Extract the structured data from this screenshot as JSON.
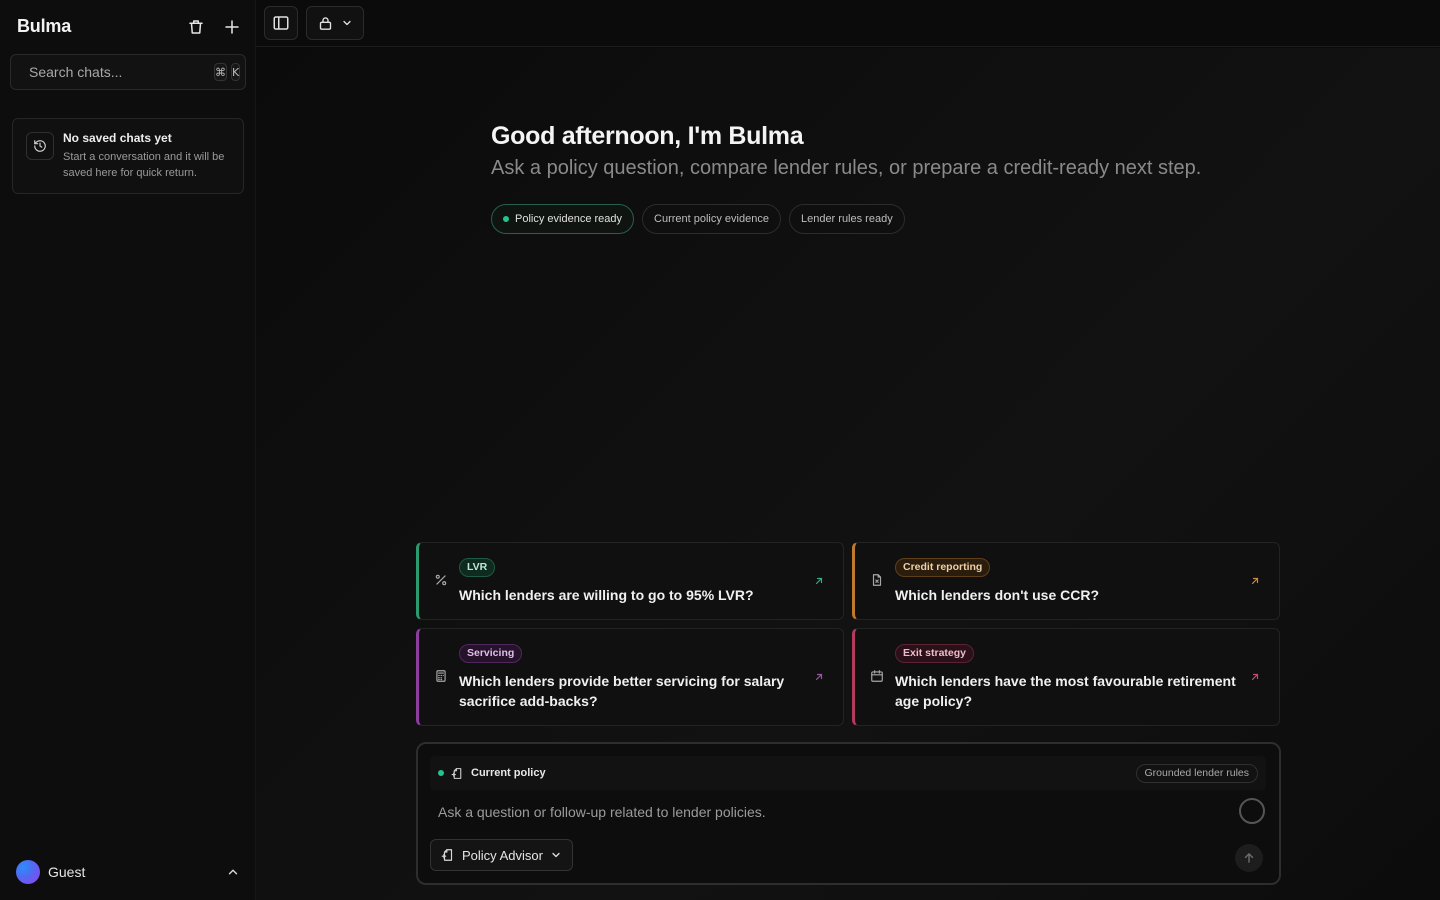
{
  "sidebar": {
    "brand": "Bulma",
    "search": {
      "placeholder": "Search chats...",
      "kbd1": "⌘",
      "kbd2": "K"
    },
    "empty": {
      "title": "No saved chats yet",
      "text": "Start a conversation and it will be saved here for quick return."
    },
    "user": {
      "name": "Guest"
    }
  },
  "hero": {
    "greeting": "Good afternoon, I'm Bulma",
    "subtitle": "Ask a policy question, compare lender rules, or prepare a credit-ready next step.",
    "pills": [
      "Policy evidence ready",
      "Current policy evidence",
      "Lender rules ready"
    ]
  },
  "cards": [
    {
      "tag": "LVR",
      "question": "Which lenders are willing to go to 95% LVR?",
      "accent": "#2a9b6e",
      "icon": "percent-icon"
    },
    {
      "tag": "Credit reporting",
      "question": "Which lenders don't use CCR?",
      "accent": "#c07a2c",
      "icon": "file-x-icon"
    },
    {
      "tag": "Servicing",
      "question": "Which lenders provide better servicing for salary sacrifice add-backs?",
      "accent": "#8d3d9c",
      "icon": "calculator-icon"
    },
    {
      "tag": "Exit strategy",
      "question": "Which lenders have the most favourable retirement age policy?",
      "accent": "#b33a5c",
      "icon": "calendar-icon"
    }
  ],
  "composer": {
    "context_label": "Current policy",
    "badge": "Grounded lender rules",
    "placeholder": "Ask a question or follow-up related to lender policies.",
    "mode": "Policy Advisor"
  }
}
